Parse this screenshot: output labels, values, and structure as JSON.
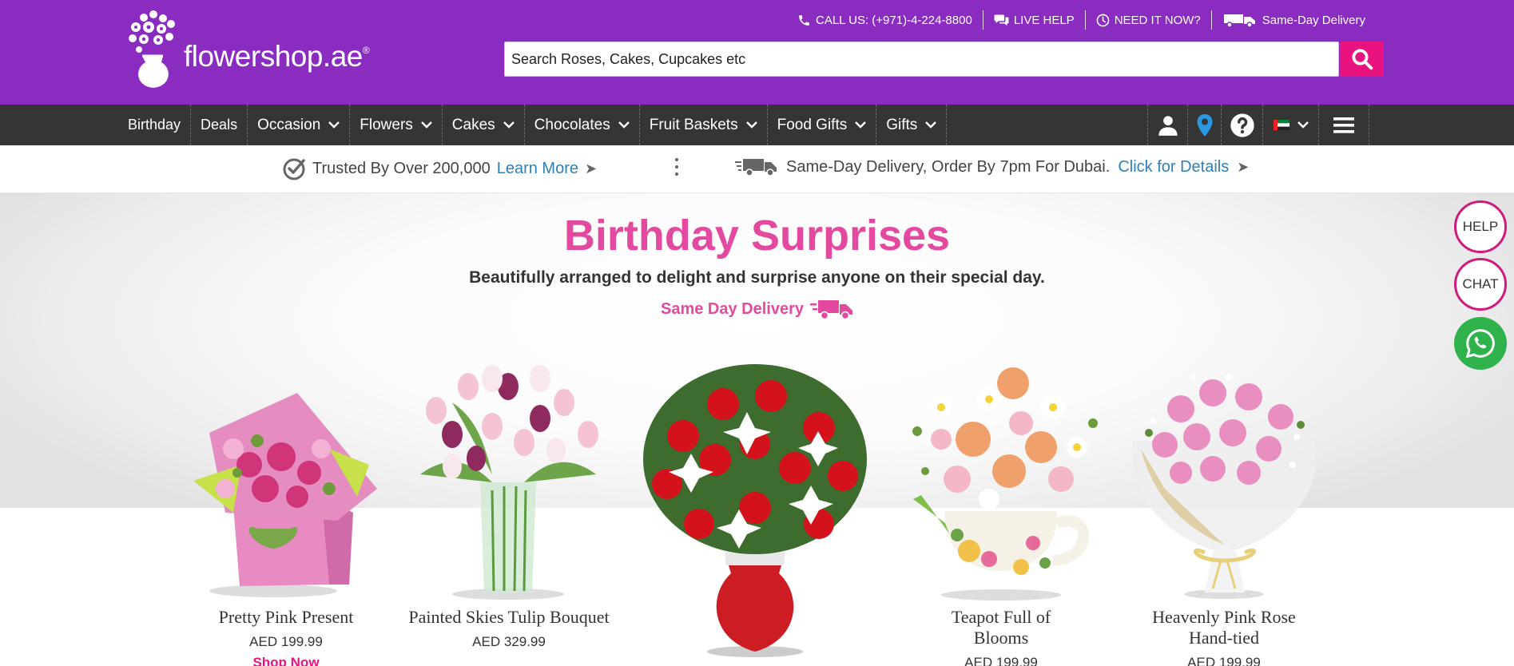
{
  "brand": {
    "name": "flowershop.ae",
    "mark": "®"
  },
  "toplinks": [
    {
      "label": "CALL US: (+971)-4-224-8800",
      "icon": "phone-icon"
    },
    {
      "label": "LIVE HELP",
      "icon": "chat-bubbles-icon"
    },
    {
      "label": "NEED IT NOW?",
      "icon": "clock-icon"
    },
    {
      "label": "Same-Day Delivery",
      "icon": "delivery-truck-icon"
    }
  ],
  "search": {
    "placeholder": "Search Roses, Cakes, Cupcakes etc",
    "button_icon": "search-icon"
  },
  "nav": {
    "items": [
      {
        "label": "Birthday",
        "dropdown": false
      },
      {
        "label": "Deals",
        "dropdown": false
      },
      {
        "label": "Occasion",
        "dropdown": true
      },
      {
        "label": "Flowers",
        "dropdown": true
      },
      {
        "label": "Cakes",
        "dropdown": true
      },
      {
        "label": "Chocolates",
        "dropdown": true
      },
      {
        "label": "Fruit Baskets",
        "dropdown": true
      },
      {
        "label": "Food Gifts",
        "dropdown": true
      },
      {
        "label": "Gifts",
        "dropdown": true
      }
    ],
    "right_icons": [
      "account-icon",
      "location-pin-icon",
      "help-icon",
      "uae-flag-icon",
      "menu-icon"
    ]
  },
  "trust_bar": {
    "left_text": "Trusted By Over 200,000",
    "left_link": "Learn More",
    "right_text": "Same-Day Delivery, Order By 7pm For Dubai.",
    "right_link": "Click for Details",
    "arrow": "➤"
  },
  "hero": {
    "title": "Birthday Surprises",
    "subtitle": "Beautifully arranged to delight and surprise anyone on their special day.",
    "delivery": "Same Day Delivery"
  },
  "products": [
    {
      "name": "Pretty Pink Present",
      "price": "AED 199.99",
      "cta": "Shop Now"
    },
    {
      "name": "Painted Skies Tulip Bouquet",
      "price": "AED 329.99"
    },
    {
      "name": "",
      "price": ""
    },
    {
      "name": "Teapot Full of Blooms",
      "price": "AED 199.99"
    },
    {
      "name": "Heavenly Pink Rose Hand-tied",
      "price": "AED 199.99"
    }
  ],
  "side_buttons": {
    "help": "HELP",
    "chat": "CHAT",
    "whatsapp_icon": "whatsapp-icon"
  },
  "colors": {
    "header_purple": "#8a2cc0",
    "nav_dark": "#353535",
    "accent_pink": "#e8137f",
    "title_pink": "#e34a9f",
    "link_blue": "#2f7fb8",
    "whatsapp_green": "#2fb24c"
  }
}
